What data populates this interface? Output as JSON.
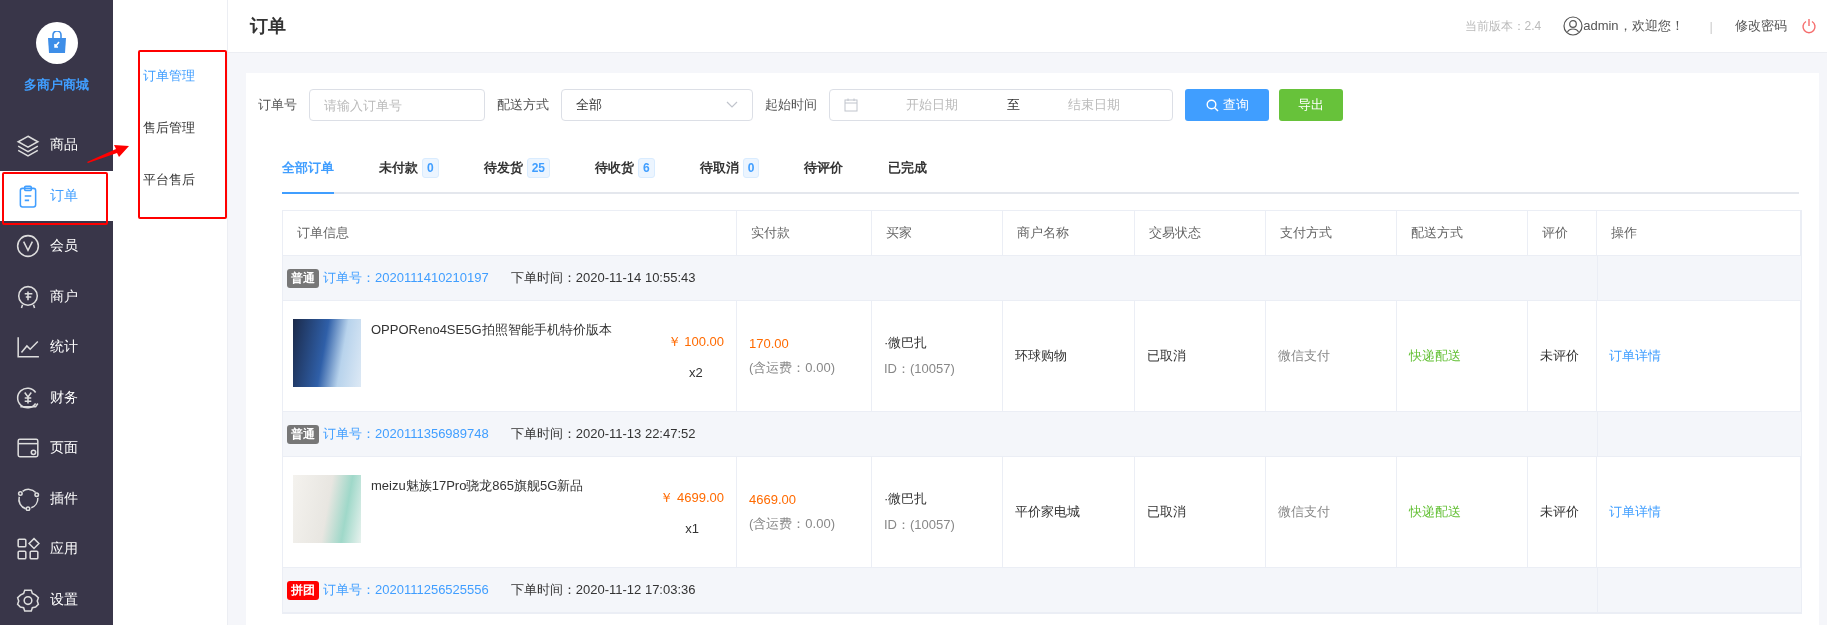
{
  "sidebar": {
    "brand": "多商户商城",
    "items": [
      {
        "label": "商品",
        "selected": false
      },
      {
        "label": "订单",
        "selected": true
      },
      {
        "label": "会员",
        "selected": false
      },
      {
        "label": "商户",
        "selected": false
      },
      {
        "label": "统计",
        "selected": false
      },
      {
        "label": "财务",
        "selected": false
      },
      {
        "label": "页面",
        "selected": false
      },
      {
        "label": "插件",
        "selected": false
      },
      {
        "label": "应用",
        "selected": false
      },
      {
        "label": "设置",
        "selected": false
      }
    ]
  },
  "submenu": {
    "items": [
      {
        "label": "订单管理",
        "selected": true
      },
      {
        "label": "售后管理",
        "selected": false
      },
      {
        "label": "平台售后",
        "selected": false
      }
    ]
  },
  "header": {
    "title": "订单",
    "version": "当前版本：2.4",
    "user": "admin，欢迎您！",
    "separator": "|",
    "change_password": "修改密码"
  },
  "filters": [
    {
      "kind": "input",
      "label": "订单号",
      "placeholder": "请输入订单号"
    },
    {
      "kind": "select",
      "label": "配送方式",
      "value": "全部"
    },
    {
      "kind": "daterange",
      "label": "起始时间",
      "start_placeholder": "开始日期",
      "separator": "至",
      "end_placeholder": "结束日期"
    }
  ],
  "buttons": [
    {
      "kind": "primary",
      "label": "查询"
    },
    {
      "kind": "success",
      "label": "导出"
    }
  ],
  "tabs": [
    {
      "label": "全部订单",
      "selected": true
    },
    {
      "label": "未付款",
      "count": "0",
      "selected": false
    },
    {
      "label": "待发货",
      "count": "25",
      "selected": false
    },
    {
      "label": "待收货",
      "count": "6",
      "selected": false
    },
    {
      "label": "待取消",
      "count": "0",
      "selected": false
    },
    {
      "label": "待评价",
      "selected": false
    },
    {
      "label": "已完成",
      "selected": false
    }
  ],
  "table": {
    "columns": [
      "订单信息",
      "实付款",
      "买家",
      "商户名称",
      "交易状态",
      "支付方式",
      "配送方式",
      "评价",
      "操作"
    ],
    "orders": [
      {
        "tag": "普通",
        "color": "#777777",
        "order_no_label": "订单号：",
        "order_no": "2020111410210197",
        "time_label": "下单时间：",
        "time": "2020-11-14 10:55:43",
        "product": {
          "name": "OPPOReno4SE5G拍照智能手机特价版本",
          "price": "￥ 100.00",
          "qty": "x2"
        },
        "paid": "170.00",
        "shipping_note": "(含运费：0.00)",
        "buyer": "·微巴扎",
        "buyer_id": "ID：(10057)",
        "merchant": "环球购物",
        "status": "已取消",
        "payment": "微信支付",
        "delivery": "快递配送",
        "review": "未评价",
        "action": "订单详情"
      },
      {
        "tag": "普通",
        "color": "#777777",
        "order_no_label": "订单号：",
        "order_no": "2020111356989748",
        "time_label": "下单时间：",
        "time": "2020-11-13 22:47:52",
        "product": {
          "name": "meizu魅族17Pro骁龙865旗舰5G新品",
          "price": "￥ 4699.00",
          "qty": "x1"
        },
        "paid": "4669.00",
        "shipping_note": "(含运费：0.00)",
        "buyer": "·微巴扎",
        "buyer_id": "ID：(10057)",
        "merchant": "平价家电城",
        "status": "已取消",
        "payment": "微信支付",
        "delivery": "快递配送",
        "review": "未评价",
        "action": "订单详情"
      },
      {
        "tag": "拼团",
        "color": "#ff0000",
        "order_no_label": "订单号：",
        "order_no": "2020111256525556",
        "time_label": "下单时间：",
        "time": "2020-11-12 17:03:36"
      }
    ]
  }
}
